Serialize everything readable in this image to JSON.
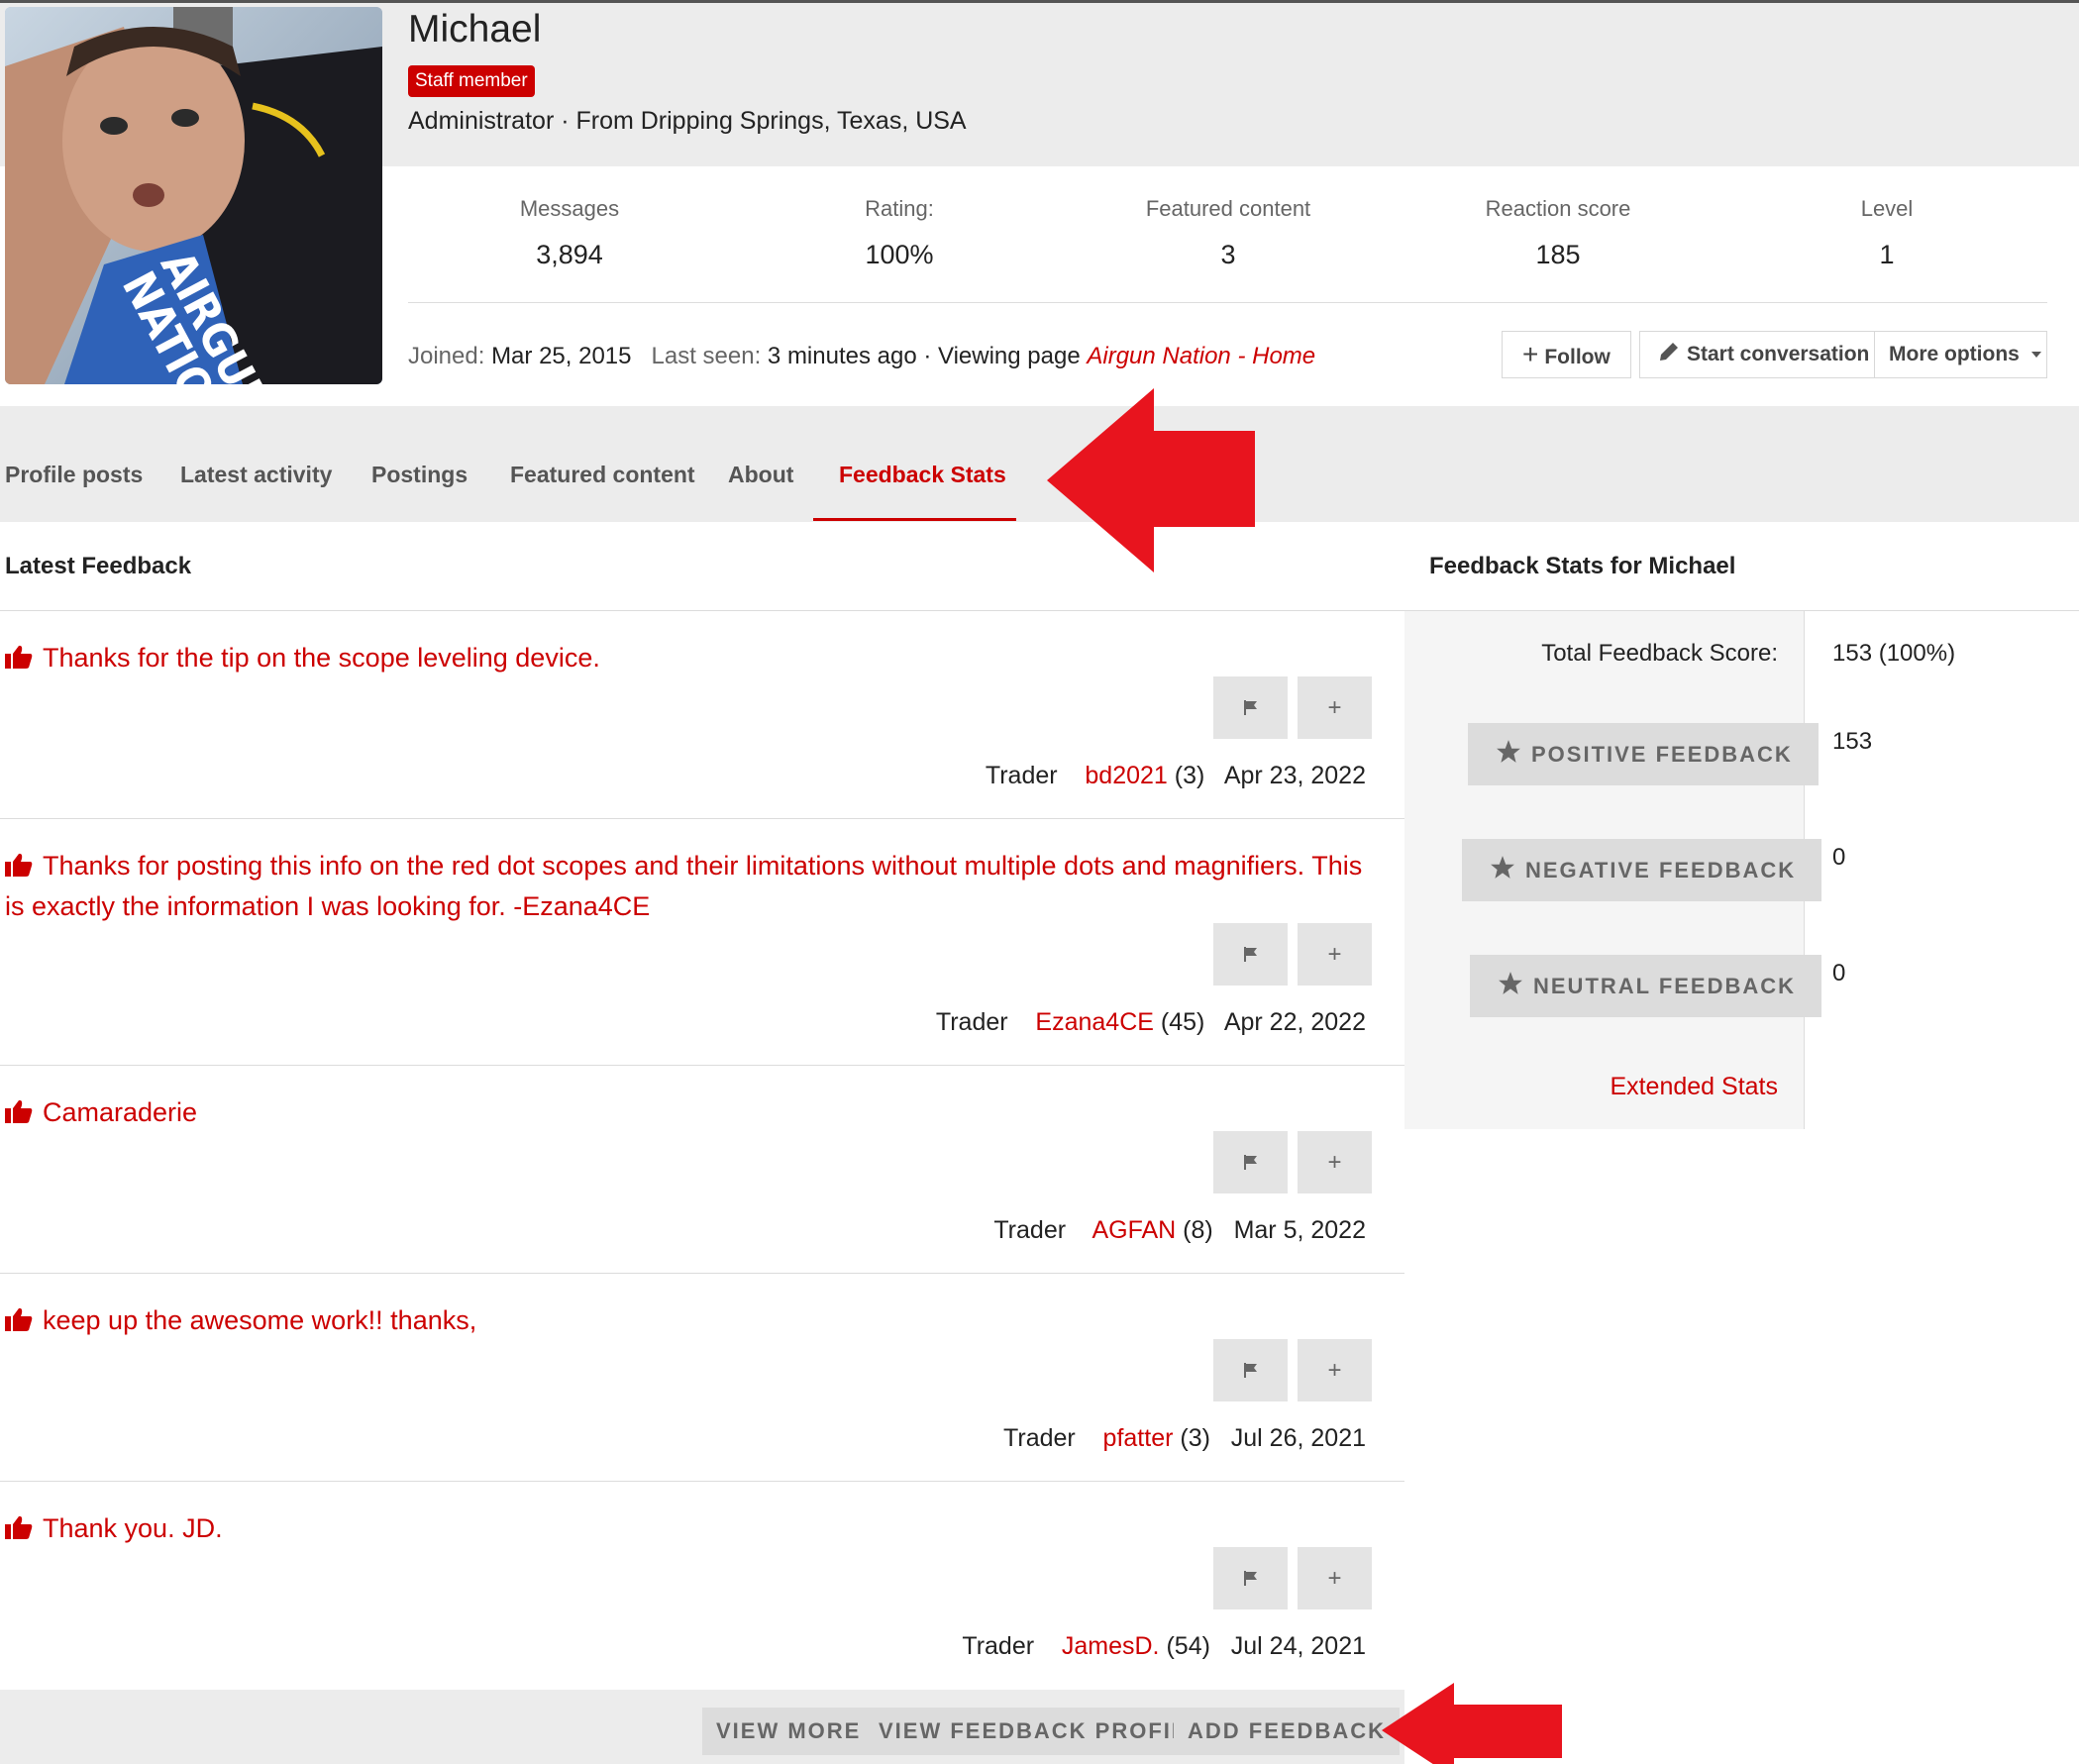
{
  "profile": {
    "username": "Michael",
    "badge": "Staff member",
    "title_line": "Administrator · From Dripping Springs, Texas, USA",
    "avatar_text": "AIRGUN NATION"
  },
  "stats": [
    {
      "label": "Messages",
      "value": "3,894"
    },
    {
      "label": "Rating:",
      "value": "100%"
    },
    {
      "label": "Featured content",
      "value": "3"
    },
    {
      "label": "Reaction score",
      "value": "185"
    },
    {
      "label": "Level",
      "value": "1"
    }
  ],
  "presence": {
    "joined_label": "Joined:",
    "joined_value": "Mar 25, 2015",
    "last_seen_label": "Last seen:",
    "last_seen_value": "3 minutes ago · Viewing page",
    "viewing_link": "Airgun Nation - Home"
  },
  "actions": {
    "follow": "Follow",
    "start_conversation": "Start conversation",
    "more_options": "More options"
  },
  "tabs": [
    {
      "label": "Profile posts"
    },
    {
      "label": "Latest activity"
    },
    {
      "label": "Postings"
    },
    {
      "label": "Featured content"
    },
    {
      "label": "About"
    },
    {
      "label": "Feedback Stats",
      "active": true
    }
  ],
  "latest_feedback": {
    "heading": "Latest Feedback",
    "items": [
      {
        "text": "Thanks for the tip on the scope leveling device.",
        "role": "Trader",
        "user": "bd2021",
        "count": "(3)",
        "date": "Apr 23, 2022"
      },
      {
        "text": "Thanks for posting this info on the red dot scopes and their limitations without multiple dots and magnifiers. This is exactly the information I was looking for. -Ezana4CE",
        "role": "Trader",
        "user": "Ezana4CE",
        "count": "(45)",
        "date": "Apr 22, 2022"
      },
      {
        "text": "Camaraderie",
        "role": "Trader",
        "user": "AGFAN",
        "count": "(8)",
        "date": "Mar 5, 2022"
      },
      {
        "text": "keep up the awesome work!! thanks,",
        "role": "Trader",
        "user": "pfatter",
        "count": "(3)",
        "date": "Jul 26, 2021"
      },
      {
        "text": "Thank you. JD.",
        "role": "Trader",
        "user": "JamesD.",
        "count": "(54)",
        "date": "Jul 24, 2021"
      }
    ],
    "plus_label": "+",
    "buttons": {
      "view_more": "VIEW MORE",
      "view_profile": "VIEW FEEDBACK PROFILE",
      "add": "ADD FEEDBACK"
    }
  },
  "feedback_stats": {
    "heading": "Feedback Stats for Michael",
    "total_label": "Total Feedback Score:",
    "total_value": "153 (100%)",
    "positive_label": "POSITIVE FEEDBACK",
    "positive_value": "153",
    "negative_label": "NEGATIVE FEEDBACK",
    "negative_value": "0",
    "neutral_label": "NEUTRAL FEEDBACK",
    "neutral_value": "0",
    "extended_link": "Extended Stats"
  },
  "colors": {
    "accent": "#cc0000",
    "annotation_arrow": "#e8141e",
    "band": "#ececec"
  }
}
